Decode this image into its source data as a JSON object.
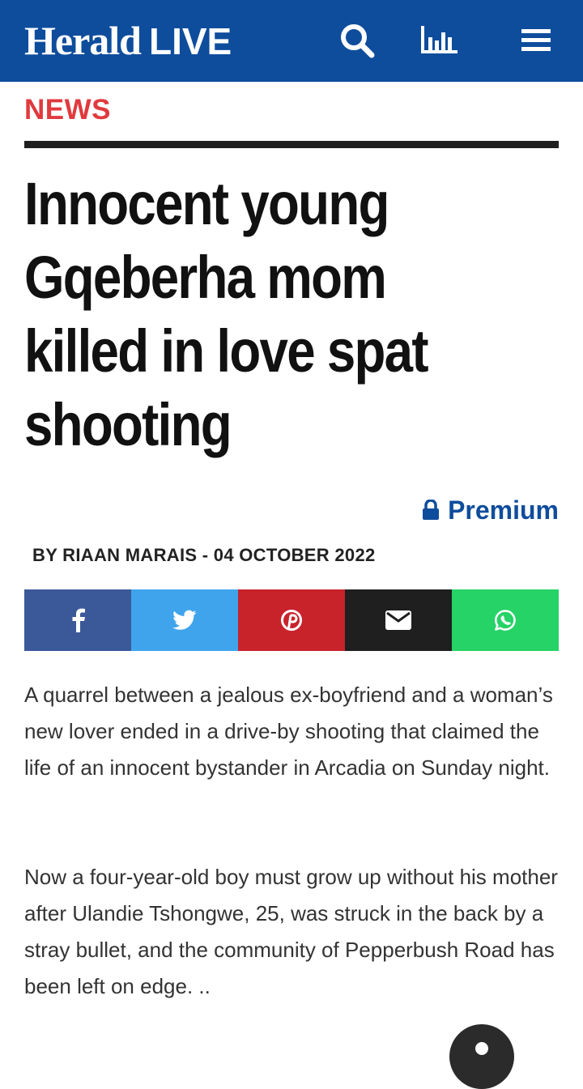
{
  "header": {
    "logo_main": "Herald",
    "logo_live": "LIVE",
    "icons": [
      "search-icon",
      "chart-icon",
      "menu-icon"
    ]
  },
  "article": {
    "section": "NEWS",
    "headline_lines": [
      "Innocent young",
      "Gqeberha mom",
      "killed in love spat",
      "shooting"
    ],
    "premium_label": "Premium",
    "byline": "BY RIAAN MARAIS - 04 OCTOBER 2022",
    "paragraphs": [
      "A quarrel between a jealous ex-boyfriend and a woman’s new lover ended in a drive-by shooting that claimed the life of an innocent bystander in Arcadia on Sunday night.",
      "Now a four-year-old boy must grow up without his mother after Ulandie Tshongwe, 25, was struck in the back by a stray bullet, and the community of Pepperbush Road has been left on edge. .."
    ]
  },
  "share": [
    {
      "name": "facebook",
      "icon": "facebook-icon",
      "color": "#3b5998"
    },
    {
      "name": "twitter",
      "icon": "twitter-icon",
      "color": "#3fa4ec"
    },
    {
      "name": "pinterest",
      "icon": "pinterest-icon",
      "color": "#c8222b"
    },
    {
      "name": "email",
      "icon": "mail-icon",
      "color": "#1f1f1f"
    },
    {
      "name": "whatsapp",
      "icon": "whatsapp-icon",
      "color": "#25d366"
    }
  ],
  "colors": {
    "brand_blue": "#0e4d9c",
    "section_red": "#e03a3e",
    "fab": "#2b2b2b"
  }
}
